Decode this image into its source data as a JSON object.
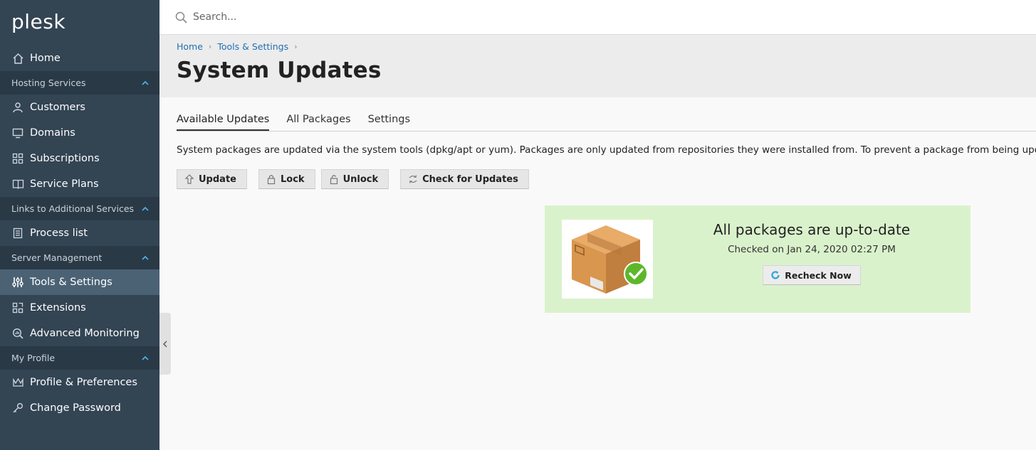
{
  "app": {
    "logo_text": "plesk"
  },
  "search": {
    "placeholder": "Search..."
  },
  "sidebar": {
    "home": "Home",
    "groups": [
      {
        "label": "Hosting Services",
        "items": [
          "Customers",
          "Domains",
          "Subscriptions",
          "Service Plans"
        ]
      },
      {
        "label": "Links to Additional Services",
        "items": [
          "Process list"
        ]
      },
      {
        "label": "Server Management",
        "items": [
          "Tools & Settings",
          "Extensions",
          "Advanced Monitoring"
        ]
      },
      {
        "label": "My Profile",
        "items": [
          "Profile & Preferences",
          "Change Password"
        ]
      }
    ],
    "active_item": "Tools & Settings"
  },
  "breadcrumb": [
    "Home",
    "Tools & Settings"
  ],
  "page": {
    "title": "System Updates"
  },
  "tabs": [
    "Available Updates",
    "All Packages",
    "Settings"
  ],
  "description": "System packages are updated via the system tools (dpkg/apt or yum). Packages are only updated from repositories they were installed from. To prevent a package from being updated, se",
  "toolbar": {
    "update": "Update",
    "lock": "Lock",
    "unlock": "Unlock",
    "check": "Check for Updates"
  },
  "status": {
    "title": "All packages are up-to-date",
    "checked": "Checked on Jan 24, 2020 02:27 PM",
    "recheck": "Recheck Now"
  },
  "colors": {
    "sidebar_bg": "#334453",
    "sidebar_active": "#4b6275",
    "link": "#1f6fb2",
    "success_bg": "#daf2cc",
    "check_green": "#5cb82a"
  },
  "icons": {
    "home": "home-icon",
    "customers": "user-icon",
    "domains": "monitor-icon",
    "subscriptions": "grid-icon",
    "service_plans": "book-icon",
    "process_list": "list-icon",
    "tools": "sliders-icon",
    "extensions": "blocks-icon",
    "monitoring": "magnifier-chart-icon",
    "profile": "crown-icon",
    "password": "key-icon"
  }
}
